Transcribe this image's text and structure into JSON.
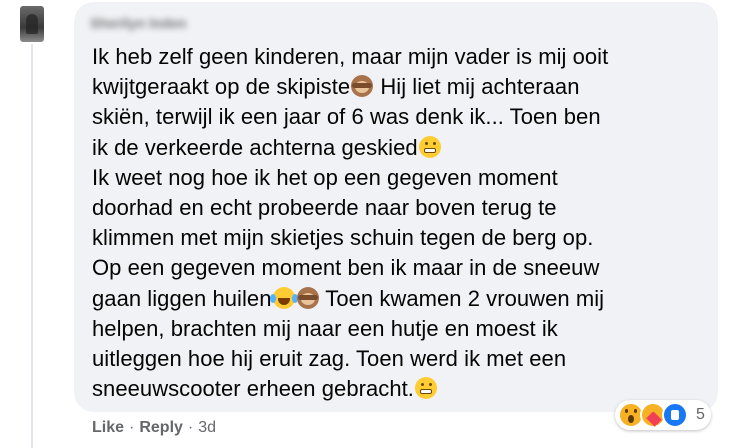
{
  "comment": {
    "author": "Sherilyn Inden",
    "lines": [
      [
        "Ik heb zelf geen kinderen, maar mijn vader is mij ooit"
      ],
      [
        "kwijtgeraakt op de skipiste",
        "monkey",
        " Hij liet mij achteraan"
      ],
      [
        "skiën, terwijl ik een jaar of 6 was denk ik... Toen ben"
      ],
      [
        "ik de verkeerde achterna geskied",
        "grimace"
      ],
      [
        "Ik weet nog hoe ik het op een gegeven moment"
      ],
      [
        "doorhad en echt probeerde naar boven terug te"
      ],
      [
        "klimmen met mijn skietjes schuin tegen de berg op."
      ],
      [
        "Op een gegeven moment ben ik maar in de sneeuw"
      ],
      [
        "gaan liggen huilen",
        "tears",
        "monkey",
        " Toen kwamen 2 vrouwen mij"
      ],
      [
        "helpen, brachten mij naar een hutje en moest ik"
      ],
      [
        "uitleggen hoe hij eruit zag. Toen werd ik met een"
      ],
      [
        "sneeuwscooter erheen gebracht.",
        "grimace"
      ]
    ]
  },
  "actions": {
    "like_label": "Like",
    "reply_label": "Reply",
    "separator": "·",
    "time": "3d"
  },
  "reactions": {
    "icons": [
      "wow-reaction-icon",
      "care-reaction-icon",
      "like-reaction-icon"
    ],
    "count": "5"
  },
  "emoji_names": {
    "monkey": "see-no-evil-monkey-emoji-icon",
    "grimace": "grimacing-face-emoji-icon",
    "tears": "tears-of-joy-emoji-icon"
  },
  "colors": {
    "bubble": "#f0f2f5",
    "text": "#050505",
    "meta": "#65676b",
    "like_blue": "#1877f2"
  }
}
